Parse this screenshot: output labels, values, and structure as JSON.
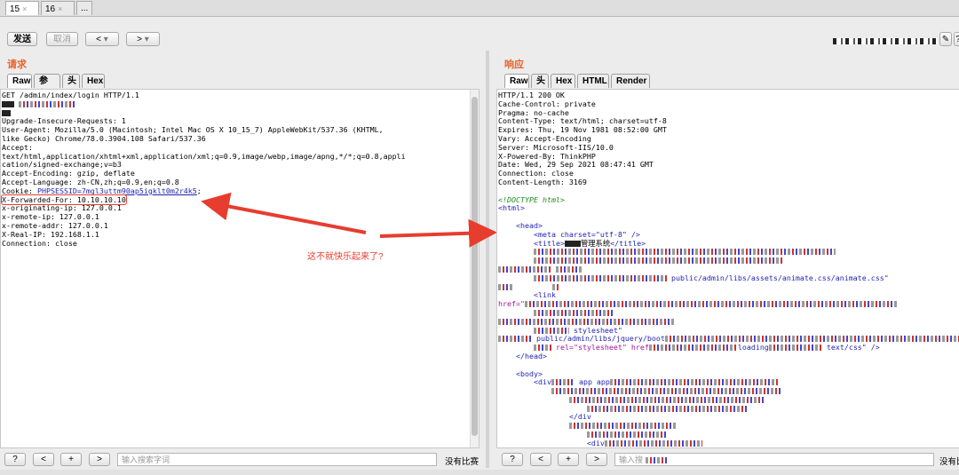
{
  "tabs": [
    {
      "label": "15",
      "close": "×"
    },
    {
      "label": "16",
      "close": "×"
    },
    {
      "label": "..."
    }
  ],
  "toolbar": {
    "send": "发送",
    "cancel": "取消",
    "back": "<",
    "forward": ">",
    "dropdown": "▾"
  },
  "request": {
    "title": "请求",
    "tabs": [
      "Raw",
      "参数",
      "头",
      "Hex"
    ],
    "lines": [
      "GET /admin/index/login HTTP/1.1",
      "Upgrade-Insecure-Requests: 1",
      "User-Agent: Mozilla/5.0 (Macintosh; Intel Mac OS X 10_15_7) AppleWebKit/537.36 (KHTML,",
      "like Gecko) Chrome/78.0.3904.108 Safari/537.36",
      "Accept:",
      "text/html,application/xhtml+xml,application/xml;q=0.9,image/webp,image/apng,*/*;q=0.8,appli",
      "cation/signed-exchange;v=b3",
      "Accept-Encoding: gzip, deflate",
      "Accept-Language: zh-CN,zh;q=0.9,en;q=0.8",
      "Cookie: ",
      "PHPSESSID=7mgl3uttm90ap5igklt0m2r4k5",
      ";",
      "X-Forwarded-For: 10.10.10.10",
      "x-originating-ip: 127.0.0.1",
      "x-remote-ip: 127.0.0.1",
      "x-remote-addr: 127.0.0.1",
      "X-Real-IP: 192.168.1.1",
      "Connection: close"
    ],
    "footer": {
      "help": "?",
      "prev": "<",
      "add": "+",
      "next": ">",
      "search_placeholder": "输入搜索字词",
      "match": "没有比赛"
    }
  },
  "response": {
    "title": "响应",
    "tabs": [
      "Raw",
      "头",
      "Hex",
      "HTML",
      "Render"
    ],
    "lines": [
      "HTTP/1.1 200 OK",
      "Cache-Control: private",
      "Pragma: no-cache",
      "Content-Type: text/html; charset=utf-8",
      "Expires: Thu, 19 Nov 1981 08:52:00 GMT",
      "Vary: Accept-Encoding",
      "Server: Microsoft-IIS/10.0",
      "X-Powered-By: ThinkPHP",
      "Date: Wed, 29 Sep 2021 08:47:41 GMT",
      "Connection: close",
      "Content-Length: 3169"
    ],
    "doctype": "<!DOCTYPE html>",
    "html_open": "<html>",
    "head_open": "<head>",
    "meta": "<meta charset=\"utf-8\" />",
    "title_tag_open": "<title>",
    "title_text": "管理系统",
    "title_tag_close": "</title>",
    "css_fragment": "public/admin/libs/assets/animate.css/animate.css\"",
    "link_open": "<link",
    "href_label": "href=\"",
    "stylesheet_fragment": "stylesheet\"",
    "bootstrap_fragment": "public/admin/libs/jquery/boot",
    "rel_stylesheet": "rel=\"stylesheet\" href",
    "loading_fragment": "loading",
    "text_css": "text/css\" />",
    "head_close": "</head>",
    "body_open": "<body>",
    "div_app": "<div",
    "app_fragment": "app app",
    "div_close": "</div",
    "div_open2": "<div",
    "footer": {
      "help": "?",
      "prev": "<",
      "add": "+",
      "next": ">",
      "search_placeholder": "输入搜",
      "match": "没有比"
    }
  },
  "annotation": {
    "text": "这不就快乐起来了?",
    "color": "#e63d2f"
  }
}
